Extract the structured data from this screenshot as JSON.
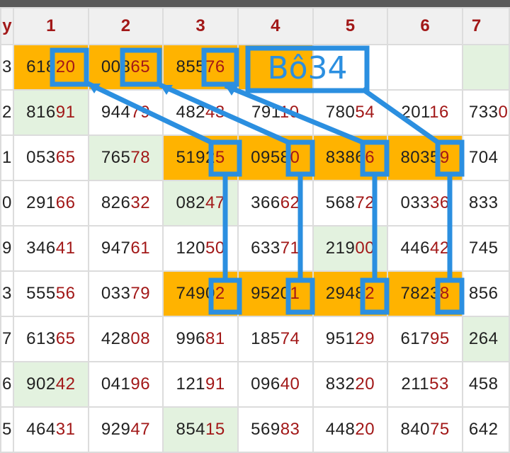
{
  "header": {
    "day_label": "y",
    "columns": [
      "1",
      "2",
      "3",
      "4",
      "5",
      "6",
      "7"
    ]
  },
  "rows": [
    {
      "day": "3",
      "cells": [
        {
          "head": "618",
          "tail": "20",
          "hl": true
        },
        {
          "head": "008",
          "tail": "65",
          "hl": true
        },
        {
          "head": "855",
          "tail": "76",
          "hl": true
        },
        {
          "head": "",
          "tail": "",
          "hl": true
        },
        {
          "head": "",
          "tail": ""
        },
        {
          "head": "",
          "tail": ""
        },
        {
          "head": "",
          "tail": "",
          "gr": true
        }
      ]
    },
    {
      "day": "2",
      "cells": [
        {
          "head": "816",
          "tail": "91",
          "gr": true
        },
        {
          "head": "944",
          "tail": "79"
        },
        {
          "head": "482",
          "tail": "43"
        },
        {
          "head": "791",
          "tail": "10"
        },
        {
          "head": "780",
          "tail": "54"
        },
        {
          "head": "201",
          "tail": "16"
        },
        {
          "head": "733",
          "tail": "0"
        }
      ]
    },
    {
      "day": "1",
      "cells": [
        {
          "head": "053",
          "tail": "65"
        },
        {
          "head": "765",
          "tail": "78",
          "gr": true
        },
        {
          "head": "5192",
          "tail": "5",
          "hl": true
        },
        {
          "head": "0958",
          "tail": "0",
          "hl": true
        },
        {
          "head": "8386",
          "tail": "6",
          "hl": true
        },
        {
          "head": "8035",
          "tail": "9",
          "hl": true
        },
        {
          "head": "704",
          "tail": ""
        }
      ]
    },
    {
      "day": "0",
      "cells": [
        {
          "head": "291",
          "tail": "66"
        },
        {
          "head": "826",
          "tail": "32"
        },
        {
          "head": "082",
          "tail": "47",
          "gr": true
        },
        {
          "head": "366",
          "tail": "62"
        },
        {
          "head": "568",
          "tail": "72"
        },
        {
          "head": "033",
          "tail": "36"
        },
        {
          "head": "833",
          "tail": ""
        }
      ]
    },
    {
      "day": "9",
      "cells": [
        {
          "head": "346",
          "tail": "41"
        },
        {
          "head": "947",
          "tail": "61"
        },
        {
          "head": "120",
          "tail": "50"
        },
        {
          "head": "633",
          "tail": "71"
        },
        {
          "head": "219",
          "tail": "00",
          "gr": true
        },
        {
          "head": "446",
          "tail": "42"
        },
        {
          "head": "745",
          "tail": ""
        }
      ]
    },
    {
      "day": "3",
      "cells": [
        {
          "head": "555",
          "tail": "56"
        },
        {
          "head": "033",
          "tail": "79"
        },
        {
          "head": "7490",
          "tail": "2",
          "hl": true
        },
        {
          "head": "9520",
          "tail": "1",
          "hl": true
        },
        {
          "head": "2948",
          "tail": "2",
          "hl": true
        },
        {
          "head": "7823",
          "tail": "8",
          "hl": true
        },
        {
          "head": "856",
          "tail": ""
        }
      ]
    },
    {
      "day": "7",
      "cells": [
        {
          "head": "613",
          "tail": "65"
        },
        {
          "head": "428",
          "tail": "08"
        },
        {
          "head": "996",
          "tail": "81"
        },
        {
          "head": "185",
          "tail": "74"
        },
        {
          "head": "951",
          "tail": "29"
        },
        {
          "head": "617",
          "tail": "95"
        },
        {
          "head": "264",
          "tail": "",
          "gr": true
        }
      ]
    },
    {
      "day": "6",
      "cells": [
        {
          "head": "902",
          "tail": "42",
          "gr": true
        },
        {
          "head": "041",
          "tail": "96"
        },
        {
          "head": "121",
          "tail": "91"
        },
        {
          "head": "096",
          "tail": "40"
        },
        {
          "head": "832",
          "tail": "20"
        },
        {
          "head": "211",
          "tail": "53"
        },
        {
          "head": "458",
          "tail": ""
        }
      ]
    },
    {
      "day": "5",
      "cells": [
        {
          "head": "464",
          "tail": "31"
        },
        {
          "head": "929",
          "tail": "47"
        },
        {
          "head": "854",
          "tail": "15",
          "gr": true
        },
        {
          "head": "569",
          "tail": "83"
        },
        {
          "head": "448",
          "tail": "20"
        },
        {
          "head": "840",
          "tail": "75"
        },
        {
          "head": "642",
          "tail": ""
        }
      ]
    }
  ],
  "annotation": {
    "text": "Bô34",
    "color": "#2b8fe0"
  },
  "colors": {
    "highlight": "#ffb300",
    "green": "#e3f2df",
    "tail": "#a21818",
    "annotation": "#2b8fe0"
  }
}
